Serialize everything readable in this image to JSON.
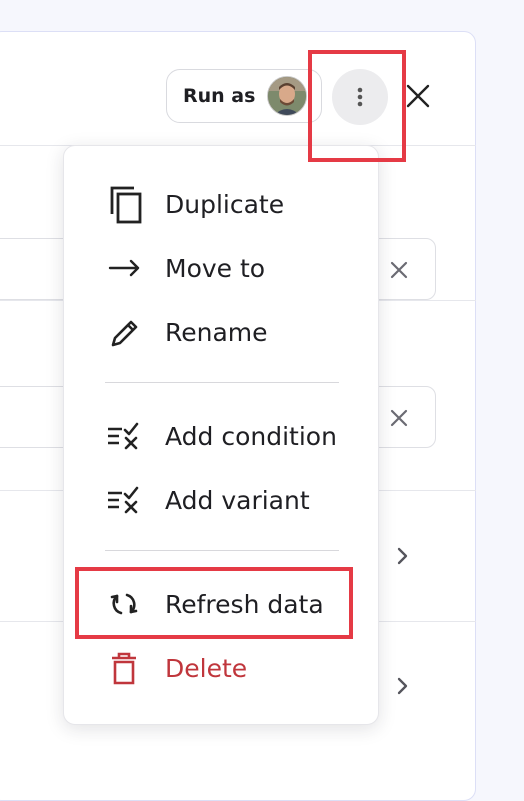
{
  "header": {
    "run_as_label": "Run as",
    "avatar": "user-avatar-photo",
    "more_icon": "more-vertical-icon",
    "close_icon": "close-icon"
  },
  "fields": [
    {
      "clear_icon": "close-icon"
    },
    {
      "clear_icon": "close-icon"
    }
  ],
  "rows": [
    {
      "icon": "chevron-right-icon"
    },
    {
      "icon": "chevron-right-icon"
    }
  ],
  "menu": {
    "items": [
      {
        "label": "Duplicate",
        "icon": "copy-icon"
      },
      {
        "label": "Move to",
        "icon": "arrow-right-icon"
      },
      {
        "label": "Rename",
        "icon": "pencil-icon"
      },
      {
        "label": "Add condition",
        "icon": "add-condition-icon"
      },
      {
        "label": "Add variant",
        "icon": "add-variant-icon"
      },
      {
        "label": "Refresh data",
        "icon": "refresh-icon"
      },
      {
        "label": "Delete",
        "icon": "trash-icon"
      }
    ]
  },
  "colors": {
    "danger": "#c0363c",
    "highlight": "#e53a45",
    "menu_bg": "#ffffff",
    "page_bg": "#f6f7fd"
  }
}
